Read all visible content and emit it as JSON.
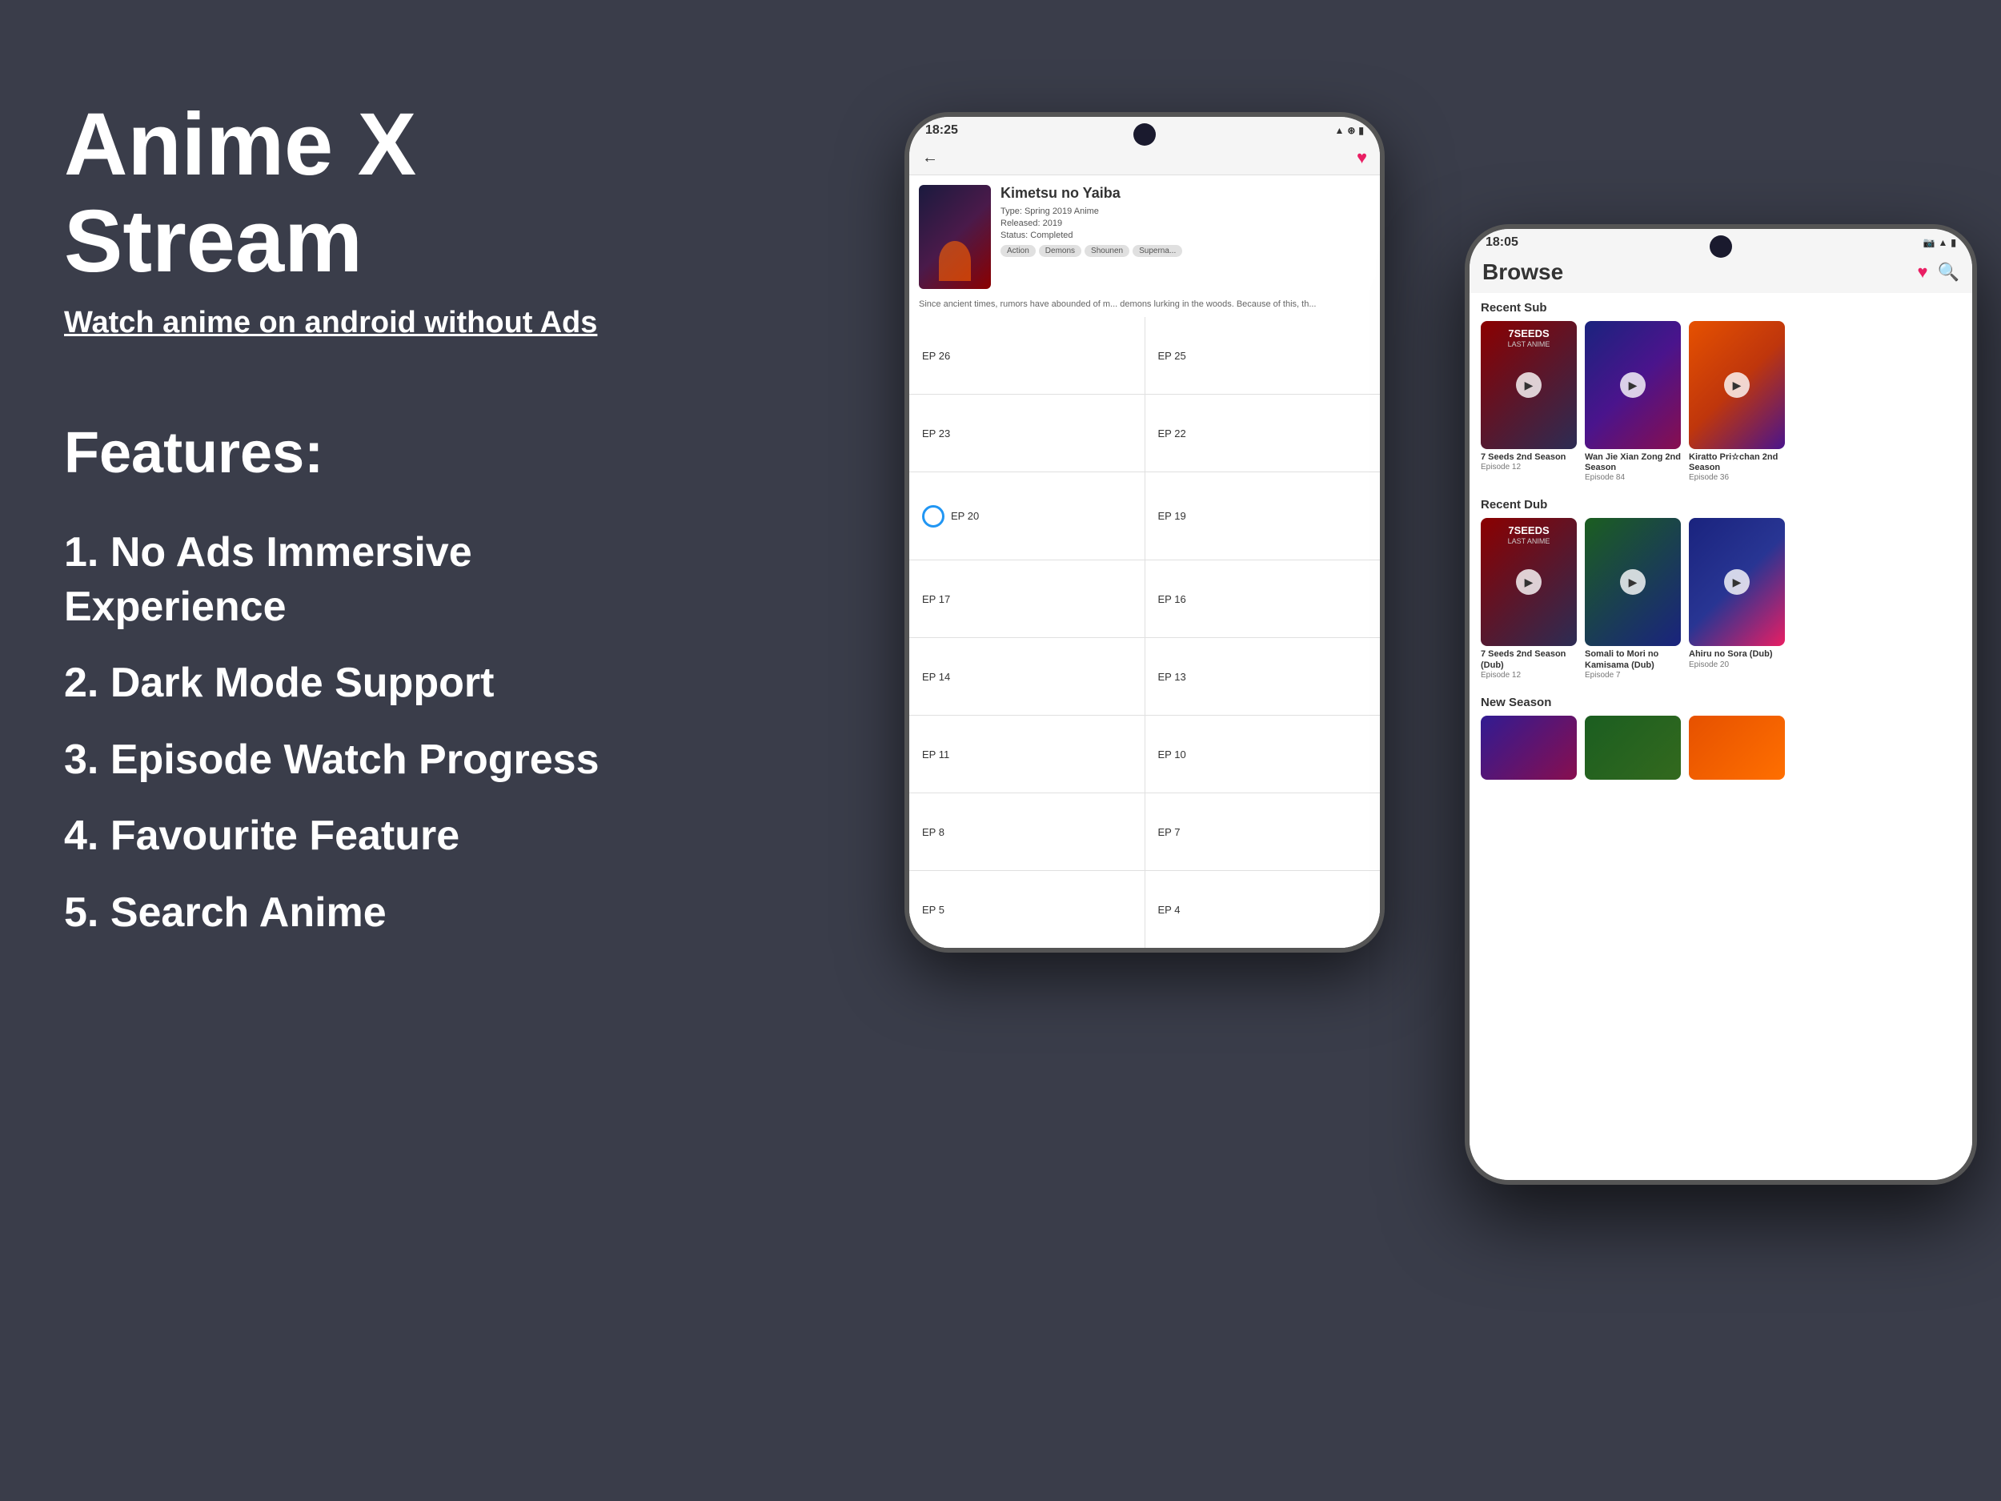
{
  "app": {
    "title": "Anime X Stream",
    "subtitle": "Watch anime on android without Ads",
    "background_color": "#3a3d4a"
  },
  "features": {
    "heading": "Features:",
    "items": [
      "1. No Ads Immersive Experience",
      "2. Dark Mode Support",
      "3. Episode Watch Progress",
      "4. Favourite Feature",
      "5. Search Anime"
    ]
  },
  "phone_back": {
    "status_time": "18:25",
    "anime_title": "Kimetsu no Yaiba",
    "anime_type": "Type: Spring 2019 Anime",
    "anime_released": "Released: 2019",
    "anime_status": "Status: Completed",
    "tags": [
      "Action",
      "Demons",
      "Shounen",
      "Superna..."
    ],
    "synopsis": "Since ancient times, rumors have abounded of m... demons lurking in the woods. Because of this, th...",
    "episodes": [
      {
        "left": "EP 26",
        "right": "EP 25"
      },
      {
        "left": "EP 23",
        "right": "EP 22"
      },
      {
        "left": "EP 20",
        "right": "EP 19",
        "has_progress": true
      },
      {
        "left": "EP 17",
        "right": "EP 16"
      },
      {
        "left": "EP 14",
        "right": "EP 13"
      },
      {
        "left": "EP 11",
        "right": "EP 10"
      },
      {
        "left": "EP 8",
        "right": "EP 7"
      },
      {
        "left": "EP 5",
        "right": "EP 4"
      }
    ]
  },
  "phone_front": {
    "status_time": "18:05",
    "browse_title": "Browse",
    "recent_sub_label": "Recent Sub",
    "recent_sub": [
      {
        "title": "7 Seeds 2nd Season",
        "episode": "Episode 12"
      },
      {
        "title": "Wan Jie Xian Zong 2nd Season",
        "episode": "Episode 84"
      },
      {
        "title": "Kiratto Pri☆chan 2nd Season",
        "episode": "Episode 36"
      }
    ],
    "recent_dub_label": "Recent Dub",
    "recent_dub": [
      {
        "title": "7 Seeds 2nd Season (Dub)",
        "episode": "Episode 12"
      },
      {
        "title": "Somali to Mori no Kamisama (Dub)",
        "episode": "Episode 7"
      },
      {
        "title": "Ahiru no Sora (Dub)",
        "episode": "Episode 20"
      }
    ],
    "new_season_label": "New Season"
  },
  "icons": {
    "heart": "♥",
    "search": "🔍",
    "back": "←",
    "play": "▶",
    "signal": "▪▪▪",
    "battery": "▮"
  }
}
